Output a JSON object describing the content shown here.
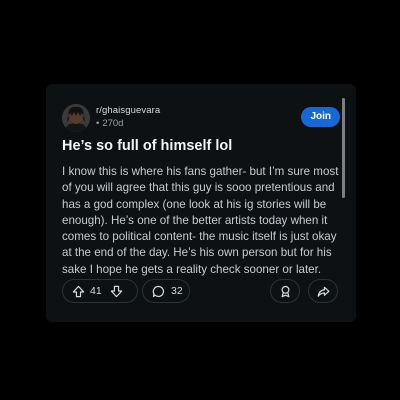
{
  "post": {
    "subreddit": "r/ghaisguevara",
    "age_dot": "•",
    "age": "270d",
    "join_label": "Join",
    "title": "He’s so full of himself lol",
    "body": "I know this is where his fans gather- but I’m sure most of you will agree that this guy is sooo pretentious and has a god complex (one look at his ig stories will be enough). He’s one of the better artists today when it comes to political content- the music itself is just okay at the end of the day. He’s his own person but for his sake I hope he gets a reality check sooner or later."
  },
  "actions": {
    "upvotes": "41",
    "comments": "32",
    "icons": [
      "upvote-icon",
      "downvote-icon",
      "comment-icon",
      "award-icon",
      "share-icon"
    ]
  },
  "colors": {
    "background": "#000000",
    "card": "#0e1113",
    "join_button": "#1767d4",
    "text_primary": "#f2f4f5",
    "text_secondary": "#c6ccd0",
    "pill_border": "#2a3236"
  }
}
